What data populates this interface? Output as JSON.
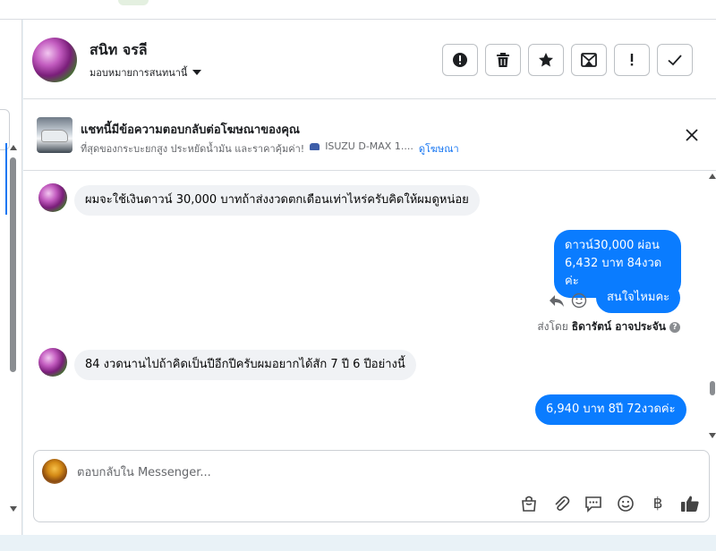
{
  "contact": {
    "name": "สนิท จรลี",
    "assign_label": "มอบหมายการสนทนานี้"
  },
  "header_actions": [
    {
      "icon": "alert-circle-icon"
    },
    {
      "icon": "trash-icon"
    },
    {
      "icon": "star-icon"
    },
    {
      "icon": "spam-icon"
    },
    {
      "icon": "exclamation-icon"
    },
    {
      "icon": "check-icon"
    }
  ],
  "ad_banner": {
    "title": "แชทนี้มีข้อความตอบกลับต่อโฆษณาของคุณ",
    "subtitle": "ที่สุดของกระบะยกสูง ประหยัดน้ำมัน และราคาคุ้มค่า!",
    "subtitle_tail": "ISUZU D-MAX 1....",
    "link": "ดูโฆษณา"
  },
  "messages": [
    {
      "direction": "in",
      "text": "ผมจะใช้เงินดาวน์ 30,000 บาทถ้าส่งงวดตกเดือนเท่าไหร่ครับคิดให้ผมดูหน่อย"
    },
    {
      "direction": "out",
      "line1": "ดาวน์30,000 ผ่อน",
      "line2": "6,432 บาท 84งวดค่ะ"
    },
    {
      "direction": "out",
      "text": "สนใจไหมคะ"
    },
    {
      "direction": "in",
      "text": "84 งวดนานไปถ้าคิดเป็นปีอีกปีครับผมอยากได้สัก 7 ปี 6 ปีอย่างนี้"
    },
    {
      "direction": "out",
      "text": "6,940 บาท 8ปี 72งวดค่ะ"
    }
  ],
  "sent_by": {
    "prefix": "ส่งโดย",
    "name": "ธิดารัตน์ อาจประจัน"
  },
  "composer": {
    "placeholder": "ตอบกลับใน Messenger...",
    "tools": [
      "shopping-bag-icon",
      "paperclip-icon",
      "saved-reply-icon",
      "emoji-icon",
      "baht-icon",
      "like-icon"
    ]
  },
  "colors": {
    "accent": "#0a7cff",
    "link": "#1877f2",
    "incoming_bg": "#f0f2f5"
  }
}
